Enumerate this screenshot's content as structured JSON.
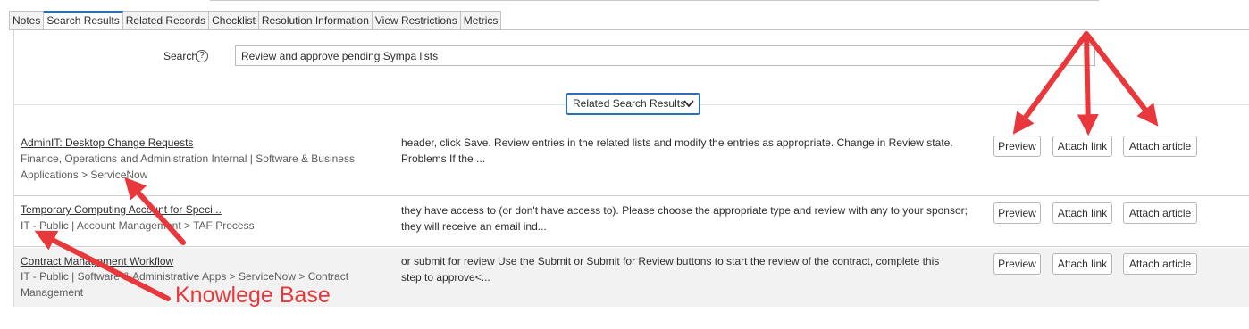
{
  "tabs": [
    {
      "label": "Notes",
      "active": false
    },
    {
      "label": "Search Results",
      "active": true
    },
    {
      "label": "Related Records",
      "active": false
    },
    {
      "label": "Checklist",
      "active": false
    },
    {
      "label": "Resolution Information",
      "active": false
    },
    {
      "label": "View Restrictions",
      "active": false
    },
    {
      "label": "Metrics",
      "active": false
    }
  ],
  "search": {
    "label": "Search",
    "help_icon": "question-circle-icon",
    "value": "Review and approve pending Sympa lists"
  },
  "results_toggle": {
    "label": "Related Search Results",
    "icon": "chevron-down-icon"
  },
  "buttons": {
    "preview": "Preview",
    "attach_link": "Attach link",
    "attach_article": "Attach article"
  },
  "results": [
    {
      "title": "AdminIT: Desktop Change Requests",
      "path_line1": "Finance, Operations and Administration Internal | Software & Business",
      "path_line2": "Applications > ServiceNow",
      "snippet_line1": "header, click Save. Review entries in the related lists and modify the entries as appropriate. Change in Review state.",
      "snippet_line2": "Problems If the ..."
    },
    {
      "title": "Temporary Computing Account for Speci...",
      "path_line1": "IT - Public | Account Management > TAF Process",
      "path_line2": "",
      "snippet_line1": "they have access to (or don't have access to). Please choose the appropriate type and review with any to your sponsor;",
      "snippet_line2": "they will receive an email ind..."
    },
    {
      "title": "Contract Management Workflow",
      "path_line1": "IT - Public | Software & Administrative Apps > ServiceNow > Contract",
      "path_line2": "Management",
      "snippet_line1": "or submit for review Use the Submit or Submit for Review buttons to start the review of the contract, complete this",
      "snippet_line2": "step to approve<..."
    }
  ],
  "annotation": {
    "label": "Knowlege Base",
    "color": "#e8383b"
  },
  "colors": {
    "accent": "#2b6fb8",
    "arrow": "#e8383b"
  }
}
